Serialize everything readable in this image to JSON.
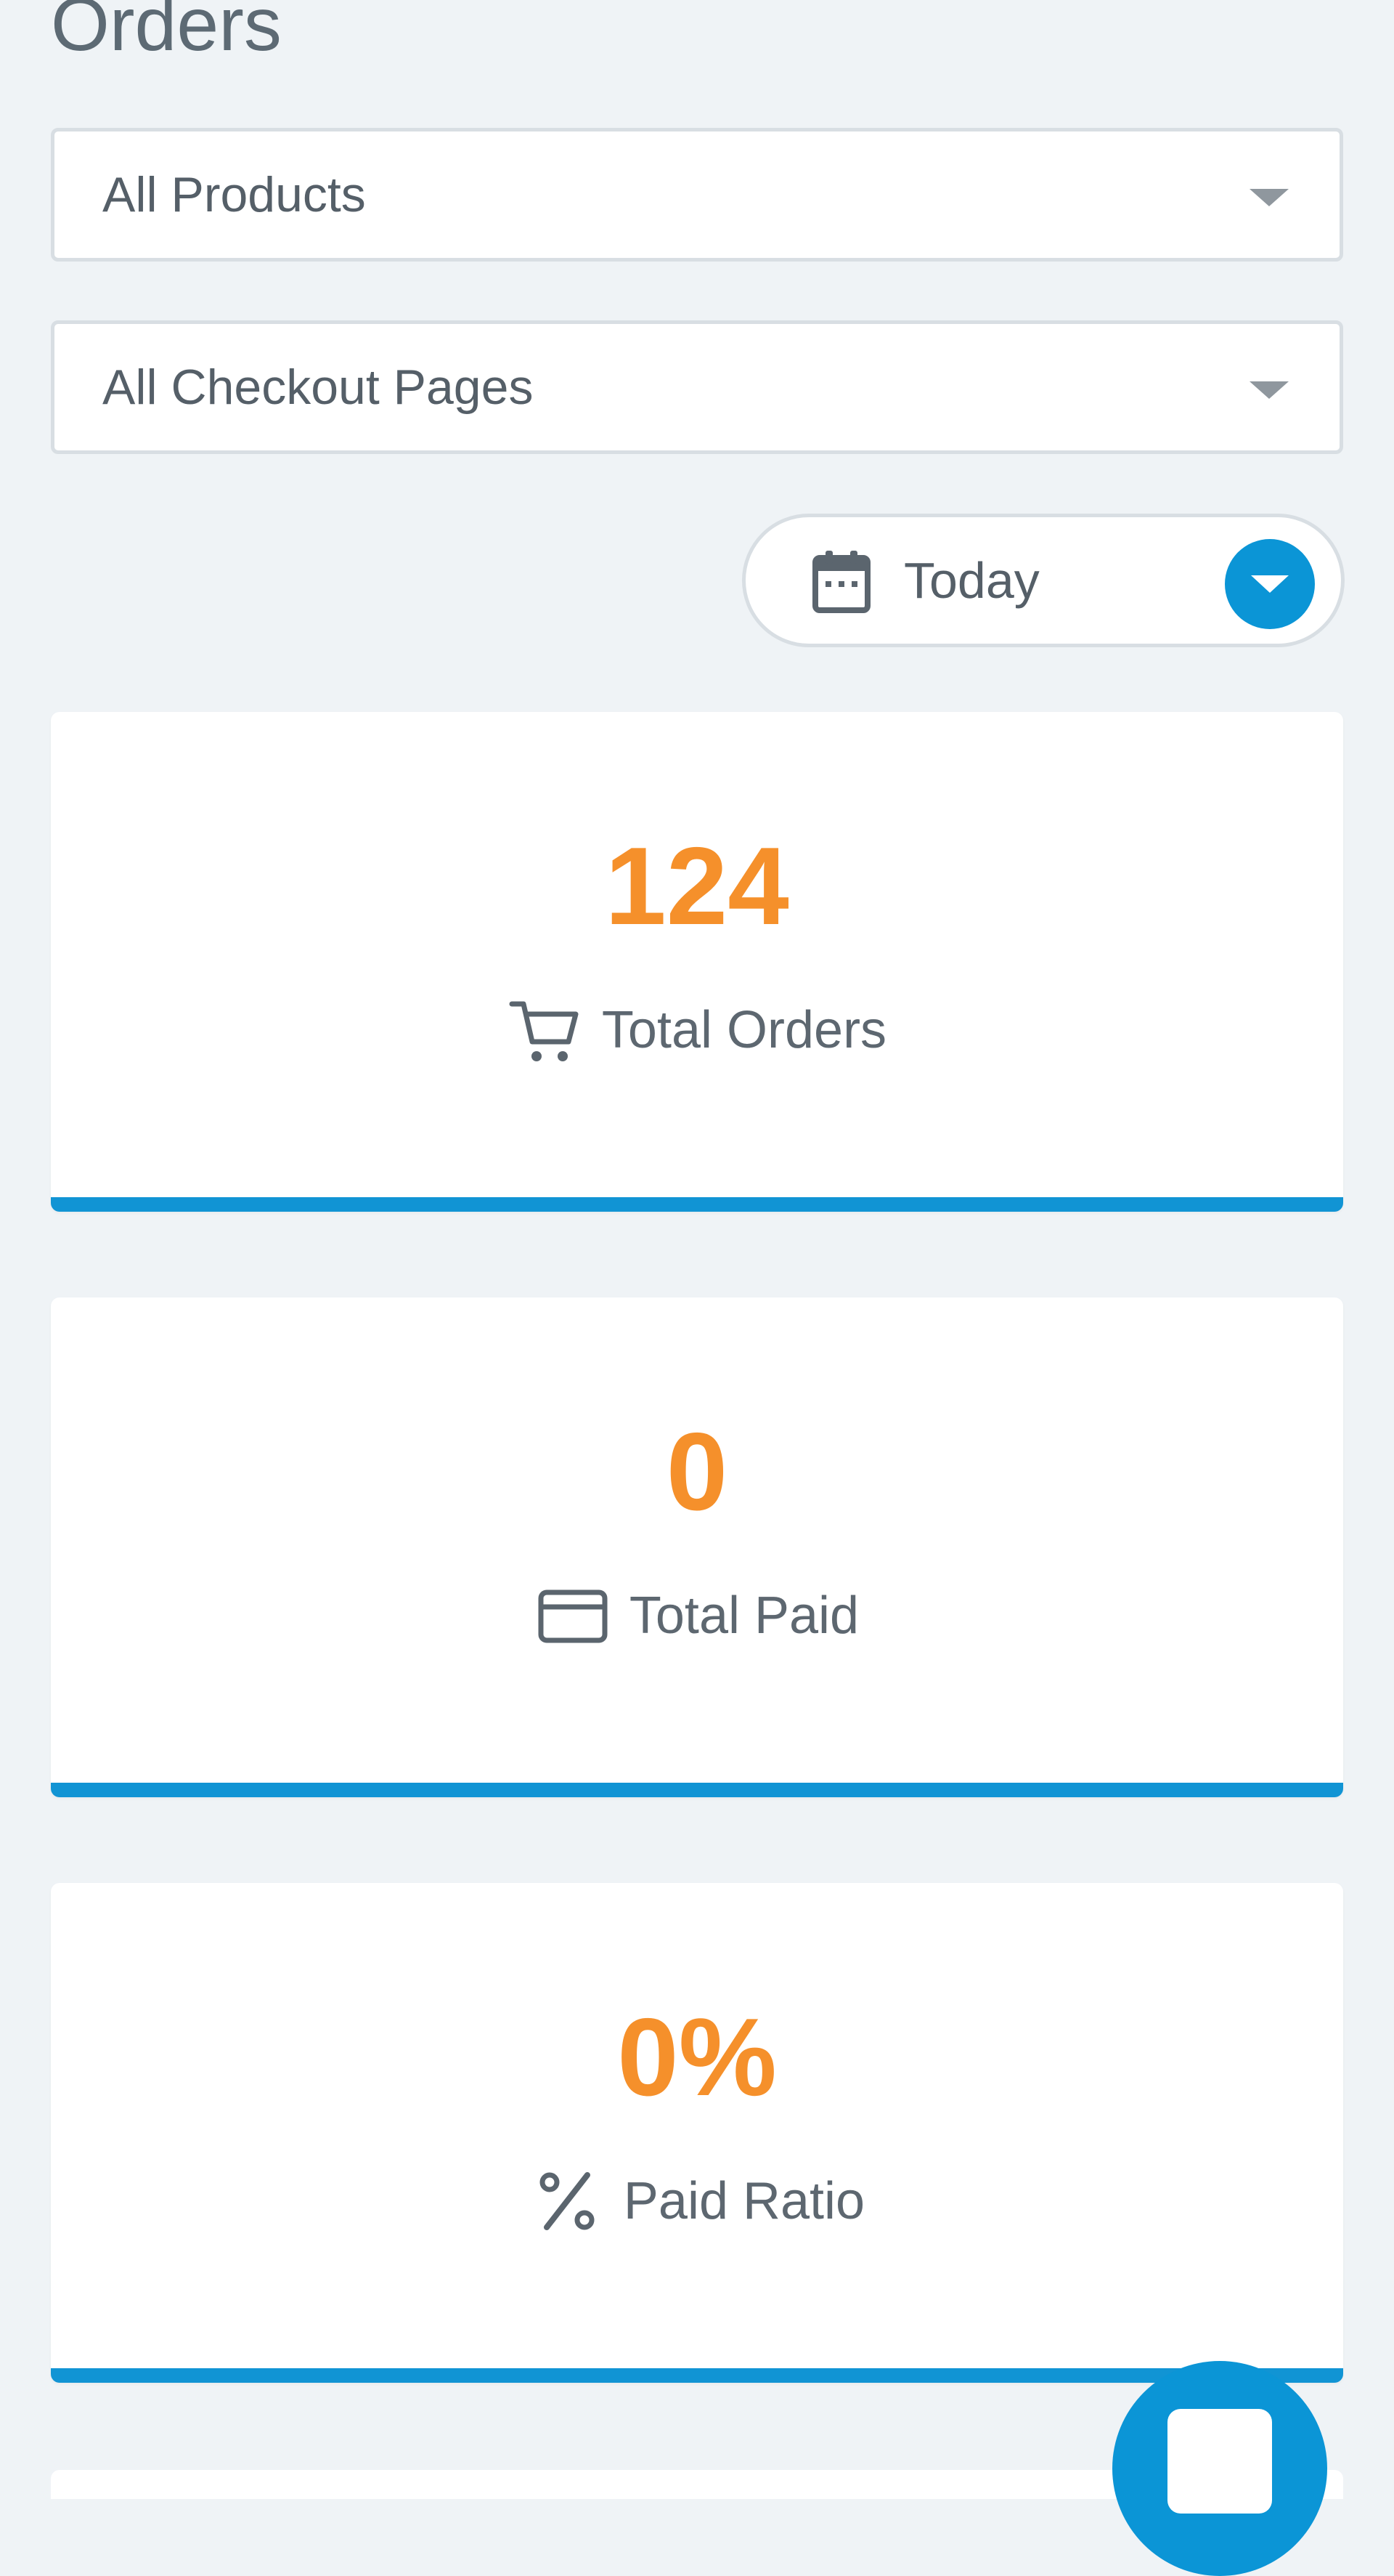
{
  "page": {
    "title": "Orders"
  },
  "filters": {
    "product_select": {
      "selected": "All Products"
    },
    "checkout_select": {
      "selected": "All Checkout Pages"
    },
    "date_range": {
      "selected": "Today"
    }
  },
  "stats": [
    {
      "value": "124",
      "label": "Total Orders",
      "icon": "cart-icon"
    },
    {
      "value": "0",
      "label": "Total Paid",
      "icon": "credit-card-icon"
    },
    {
      "value": "0%",
      "label": "Paid Ratio",
      "icon": "percent-icon"
    }
  ],
  "colors": {
    "accent": "#1194d4",
    "value": "#f5902b",
    "background": "#eff3f6"
  }
}
